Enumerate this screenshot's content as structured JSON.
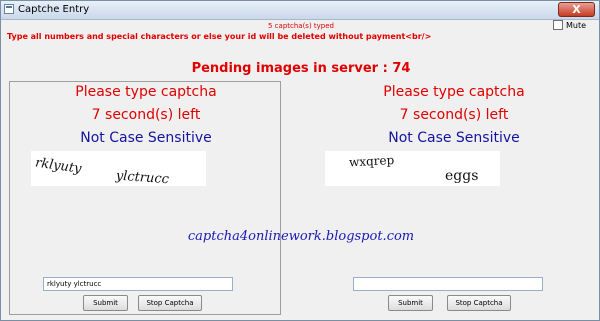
{
  "window": {
    "title": "Captche Entry",
    "close_label": "X"
  },
  "status": "5 captcha(s) typed",
  "mute_label": "Mute",
  "warning": "Type all numbers and special characters or else your id will be deleted without payment<br/>",
  "pending": "Pending images in server : 74",
  "panels": [
    {
      "prompt": "Please type captcha",
      "timer": "7 second(s) left",
      "case_note": "Not Case Sensitive",
      "captcha_text": "rklyuty ylctrucc",
      "input_value": "rklyuty ylctrucc",
      "submit_label": "Submit",
      "stop_label": "Stop Captcha"
    },
    {
      "prompt": "Please type captcha",
      "timer": "7 second(s) left",
      "case_note": "Not Case Sensitive",
      "captcha_text": "wxqrep eggs",
      "input_value": "",
      "submit_label": "Submit",
      "stop_label": "Stop Captcha"
    }
  ],
  "watermark": "captcha4onlinework.blogspot.com",
  "icons": {
    "title": "app-icon",
    "close": "close-icon"
  }
}
